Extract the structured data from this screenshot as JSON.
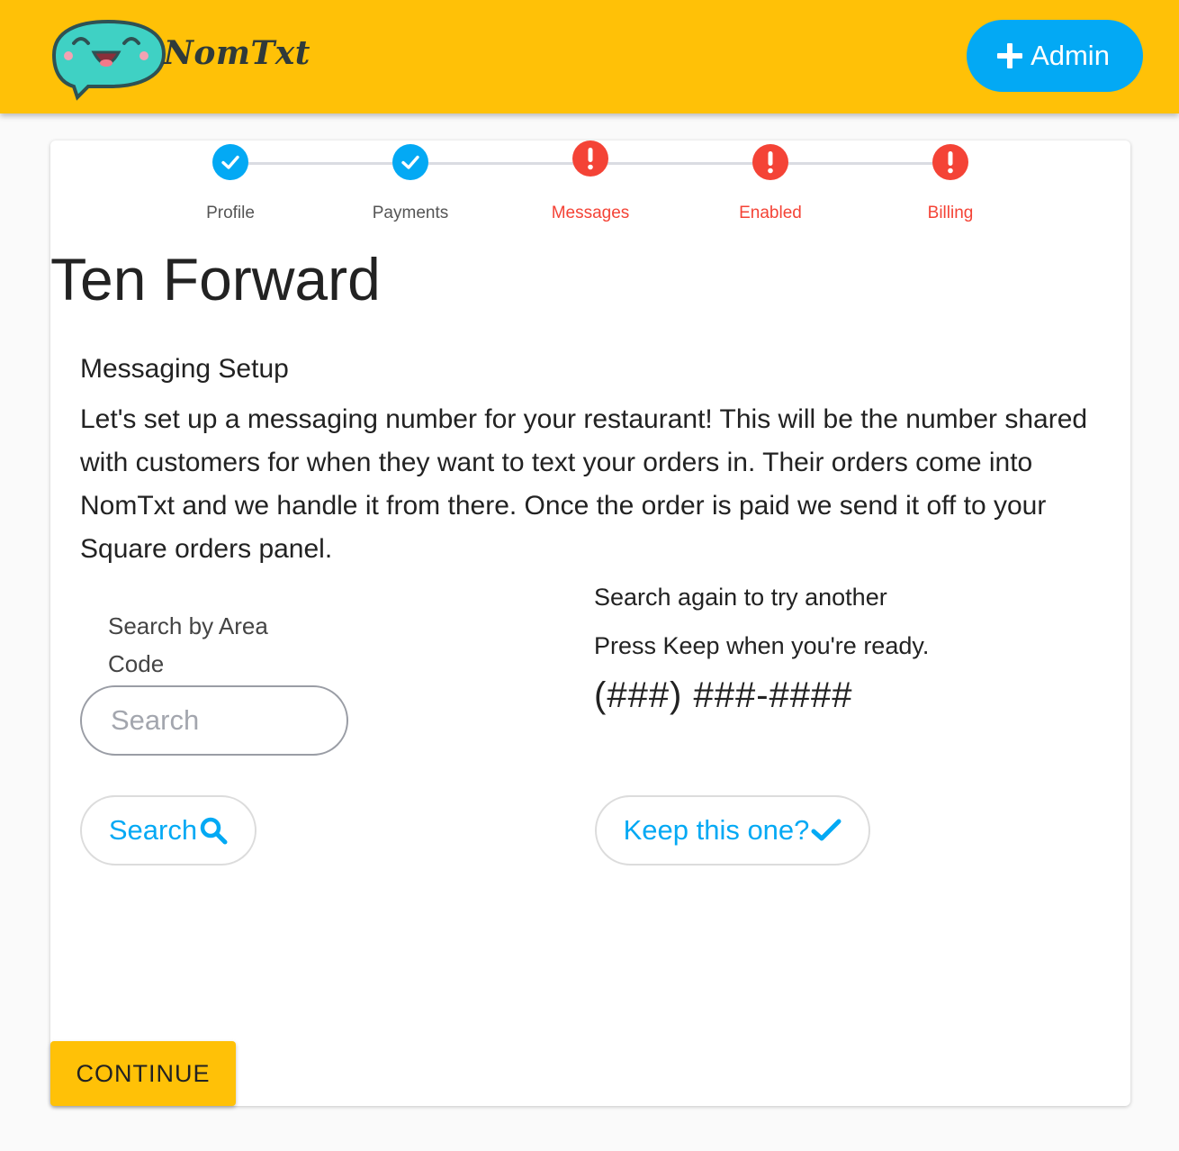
{
  "header": {
    "brand": "NomTxt",
    "admin_label": "Admin",
    "colors": {
      "bar": "#ffc107",
      "admin_button": "#03a9f4"
    }
  },
  "stepper": {
    "steps": [
      {
        "label": "Profile",
        "status": "complete",
        "icon": "check-icon"
      },
      {
        "label": "Payments",
        "status": "complete",
        "icon": "check-icon"
      },
      {
        "label": "Messages",
        "status": "error",
        "icon": "exclamation-icon"
      },
      {
        "label": "Enabled",
        "status": "error",
        "icon": "exclamation-icon"
      },
      {
        "label": "Billing",
        "status": "error",
        "icon": "exclamation-icon"
      }
    ],
    "colors": {
      "complete": "#03a9f4",
      "error": "#f44336"
    }
  },
  "page": {
    "restaurant_name": "Ten Forward",
    "section_title": "Messaging Setup",
    "intro": "Let's set up a messaging number for your restaurant! This will be the number shared with customers for when they want to text your orders in. Their orders come into NomTxt and we handle it from there. Once the order is paid we send it off to your Square orders panel."
  },
  "search": {
    "label": "Search by Area Code",
    "placeholder": "Search",
    "value": "",
    "button_label": "Search"
  },
  "result": {
    "hint_search_again": "Search again to try another",
    "hint_keep": "Press Keep when you're ready.",
    "phone_number": "(###) ###-####",
    "keep_label": "Keep this one?"
  },
  "footer": {
    "continue_label": "CONTINUE"
  }
}
